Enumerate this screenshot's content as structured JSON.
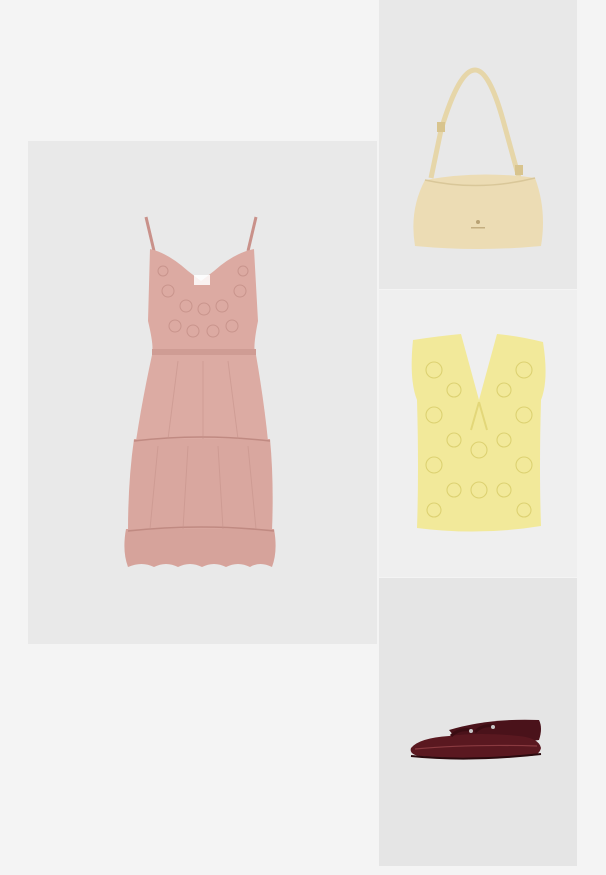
{
  "board": {
    "items": [
      {
        "name": "dress",
        "icon": "pink-tiered-crochet-dress",
        "color": "#d9a9a2"
      },
      {
        "name": "handbag",
        "icon": "cream-shoulder-bag",
        "color": "#ecdcb4"
      },
      {
        "name": "vest",
        "icon": "yellow-crochet-vest",
        "color": "#f2e99a"
      },
      {
        "name": "flats",
        "icon": "burgundy-patent-mary-jane-flats",
        "color": "#5a1820"
      }
    ]
  }
}
